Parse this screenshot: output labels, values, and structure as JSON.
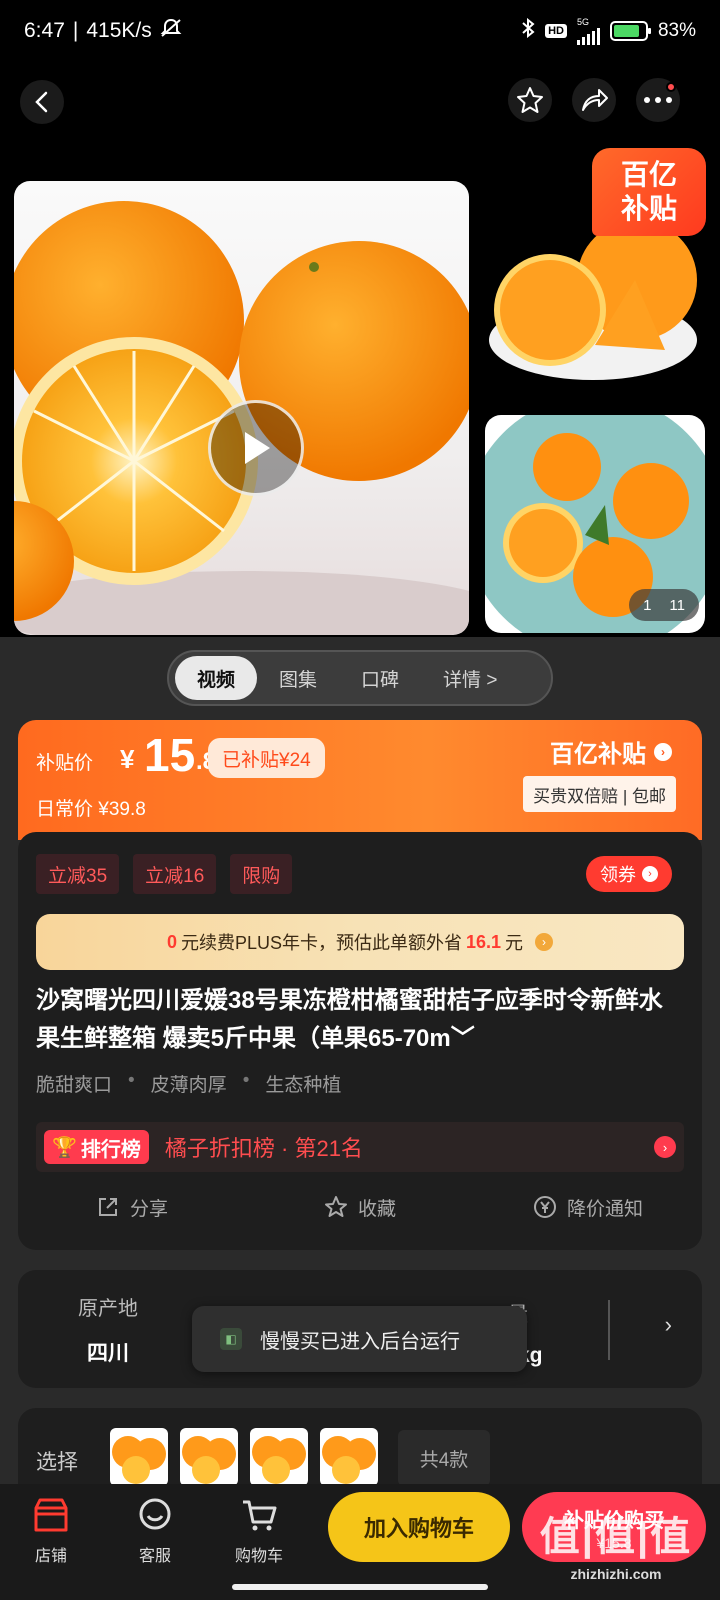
{
  "status_bar": {
    "time": "6:47",
    "speed": "415K/s",
    "network": "5G",
    "hd": "HD",
    "battery": "83%"
  },
  "top_nav": {
    "icons": [
      "back-icon",
      "star-icon",
      "share-icon",
      "more-icon"
    ]
  },
  "gallery": {
    "badge_line1": "百亿",
    "badge_line2": "补贴",
    "page_current": "1",
    "page_total": "11"
  },
  "media_tabs": [
    "视频",
    "图集",
    "口碑",
    "详情 >"
  ],
  "price": {
    "label": "补贴价",
    "currency": "¥",
    "integer": "15",
    "decimal": ".8",
    "subsidized": "已补贴¥24",
    "normal_price": "日常价 ¥39.8",
    "brand": "百亿补贴",
    "promise": "买贵双倍赔 | 包邮"
  },
  "promo_tags": [
    "立减35",
    "立减16",
    "限购"
  ],
  "coupon_label": "领券",
  "plus_bar": {
    "prefix": "0",
    "text": "元续费PLUS年卡，预估此单额外省",
    "amount": "16.1",
    "suffix": "元"
  },
  "product_title": "沙窝曙光四川爱媛38号果冻橙柑橘蜜甜桔子应季时令新鲜水果生鲜整箱 爆卖5斤中果（单果65-70m﹀",
  "features": [
    "脆甜爽口",
    "皮薄肉厚",
    "生态种植"
  ],
  "rank": {
    "badge": "排行榜",
    "text": "橘子折扣榜 · 第21名"
  },
  "actions": {
    "share": "分享",
    "favorite": "收藏",
    "price_alert": "降价通知"
  },
  "specs": {
    "origin_label": "原产地",
    "origin_value": "四川",
    "weight_label_partial": "量",
    "weight_value_partial": "kg"
  },
  "toast": "慢慢买已进入后台运行",
  "variants": {
    "label": "选择",
    "count": "共4款"
  },
  "bottom_bar": {
    "store": "店铺",
    "service": "客服",
    "cart": "购物车",
    "add_to_cart": "加入购物车",
    "buy_now": "补贴价购买",
    "buy_sub": "¥15.8"
  },
  "watermark": {
    "big": "值|值|值",
    "small": "zhizhizhi.com"
  },
  "colors": {
    "accent_orange": "#ff6a1f",
    "subsidy_red": "#ff3b52",
    "cart_yellow": "#f5c518"
  }
}
